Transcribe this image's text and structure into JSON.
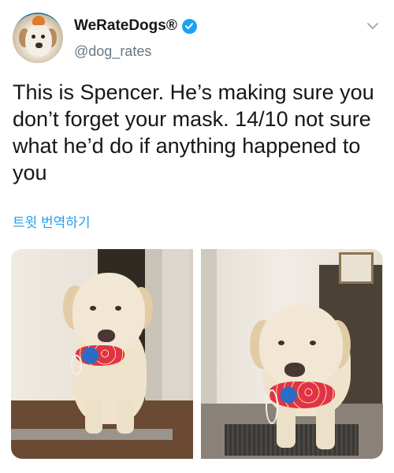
{
  "account": {
    "display_name": "WeRateDogs®",
    "handle": "@dog_rates",
    "verified": true
  },
  "tweet": {
    "text": "This is Spencer. He’s making sure you don’t forget your mask. 14/10 not sure what he’d do if anything happened to you",
    "translate_label": "트윗 번역하기"
  },
  "media": {
    "count": 2
  },
  "colors": {
    "link": "#1da1f2",
    "verified": "#1da1f2",
    "secondary_text": "#657786"
  },
  "icons": {
    "verified": "verified-badge-icon",
    "menu": "chevron-down-icon"
  }
}
